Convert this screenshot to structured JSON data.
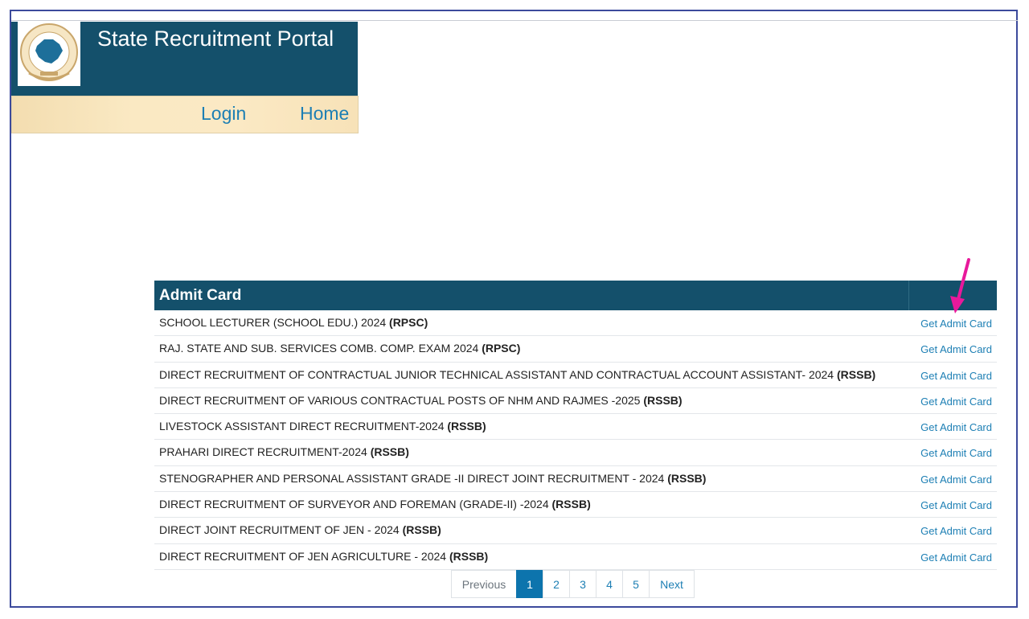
{
  "header": {
    "title": "State Recruitment Portal",
    "nav": {
      "login": "Login",
      "home": "Home"
    }
  },
  "admit_card": {
    "heading": "Admit Card",
    "rows": [
      {
        "title": "SCHOOL LECTURER (SCHOOL EDU.) 2024 ",
        "agency": "(RPSC)",
        "link": "Get Admit Card"
      },
      {
        "title": "RAJ. STATE AND SUB. SERVICES COMB. COMP. EXAM 2024 ",
        "agency": "(RPSC)",
        "link": "Get Admit Card"
      },
      {
        "title": "DIRECT RECRUITMENT OF CONTRACTUAL JUNIOR TECHNICAL ASSISTANT AND CONTRACTUAL ACCOUNT ASSISTANT- 2024 ",
        "agency": "(RSSB)",
        "link": "Get Admit Card"
      },
      {
        "title": "DIRECT RECRUITMENT OF VARIOUS CONTRACTUAL POSTS OF NHM AND RAJMES -2025 ",
        "agency": "(RSSB)",
        "link": "Get Admit Card"
      },
      {
        "title": "LIVESTOCK ASSISTANT DIRECT RECRUITMENT-2024 ",
        "agency": "(RSSB)",
        "link": "Get Admit Card"
      },
      {
        "title": "PRAHARI DIRECT RECRUITMENT-2024 ",
        "agency": "(RSSB)",
        "link": "Get Admit Card"
      },
      {
        "title": "STENOGRAPHER AND PERSONAL ASSISTANT GRADE -II DIRECT JOINT RECRUITMENT - 2024 ",
        "agency": "(RSSB)",
        "link": "Get Admit Card"
      },
      {
        "title": "DIRECT RECRUITMENT OF SURVEYOR AND FOREMAN (GRADE-II) -2024 ",
        "agency": "(RSSB)",
        "link": "Get Admit Card"
      },
      {
        "title": "DIRECT JOINT RECRUITMENT OF JEN - 2024 ",
        "agency": "(RSSB)",
        "link": "Get Admit Card"
      },
      {
        "title": "DIRECT RECRUITMENT OF JEN AGRICULTURE - 2024 ",
        "agency": "(RSSB)",
        "link": "Get Admit Card"
      }
    ]
  },
  "pagination": {
    "previous": "Previous",
    "pages": [
      "1",
      "2",
      "3",
      "4",
      "5"
    ],
    "active_page": "1",
    "next": "Next"
  },
  "colors": {
    "header_bg": "#14506b",
    "link": "#1d7fb4",
    "active_page": "#0d74ad",
    "arrow": "#e8199b"
  },
  "icons": {
    "logo": "rajasthan-map-emblem",
    "annotation": "magenta-arrow"
  }
}
